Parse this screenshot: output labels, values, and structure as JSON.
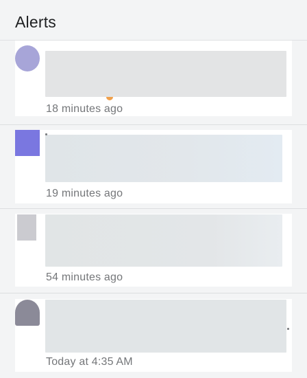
{
  "header": {
    "title": "Alerts"
  },
  "alerts": [
    {
      "avatar": "avatar-user-1",
      "timestamp": "18 minutes ago"
    },
    {
      "avatar": "avatar-user-2",
      "timestamp": "19 minutes ago"
    },
    {
      "avatar": "avatar-user-3",
      "timestamp": "54 minutes ago"
    },
    {
      "avatar": "avatar-user-4",
      "timestamp": "Today at 4:35 AM"
    }
  ],
  "colors": {
    "background": "#f3f4f5",
    "card": "#ffffff",
    "title_text": "#1e1f21",
    "timestamp_text": "#747679",
    "redaction": "#e1e5e7"
  }
}
